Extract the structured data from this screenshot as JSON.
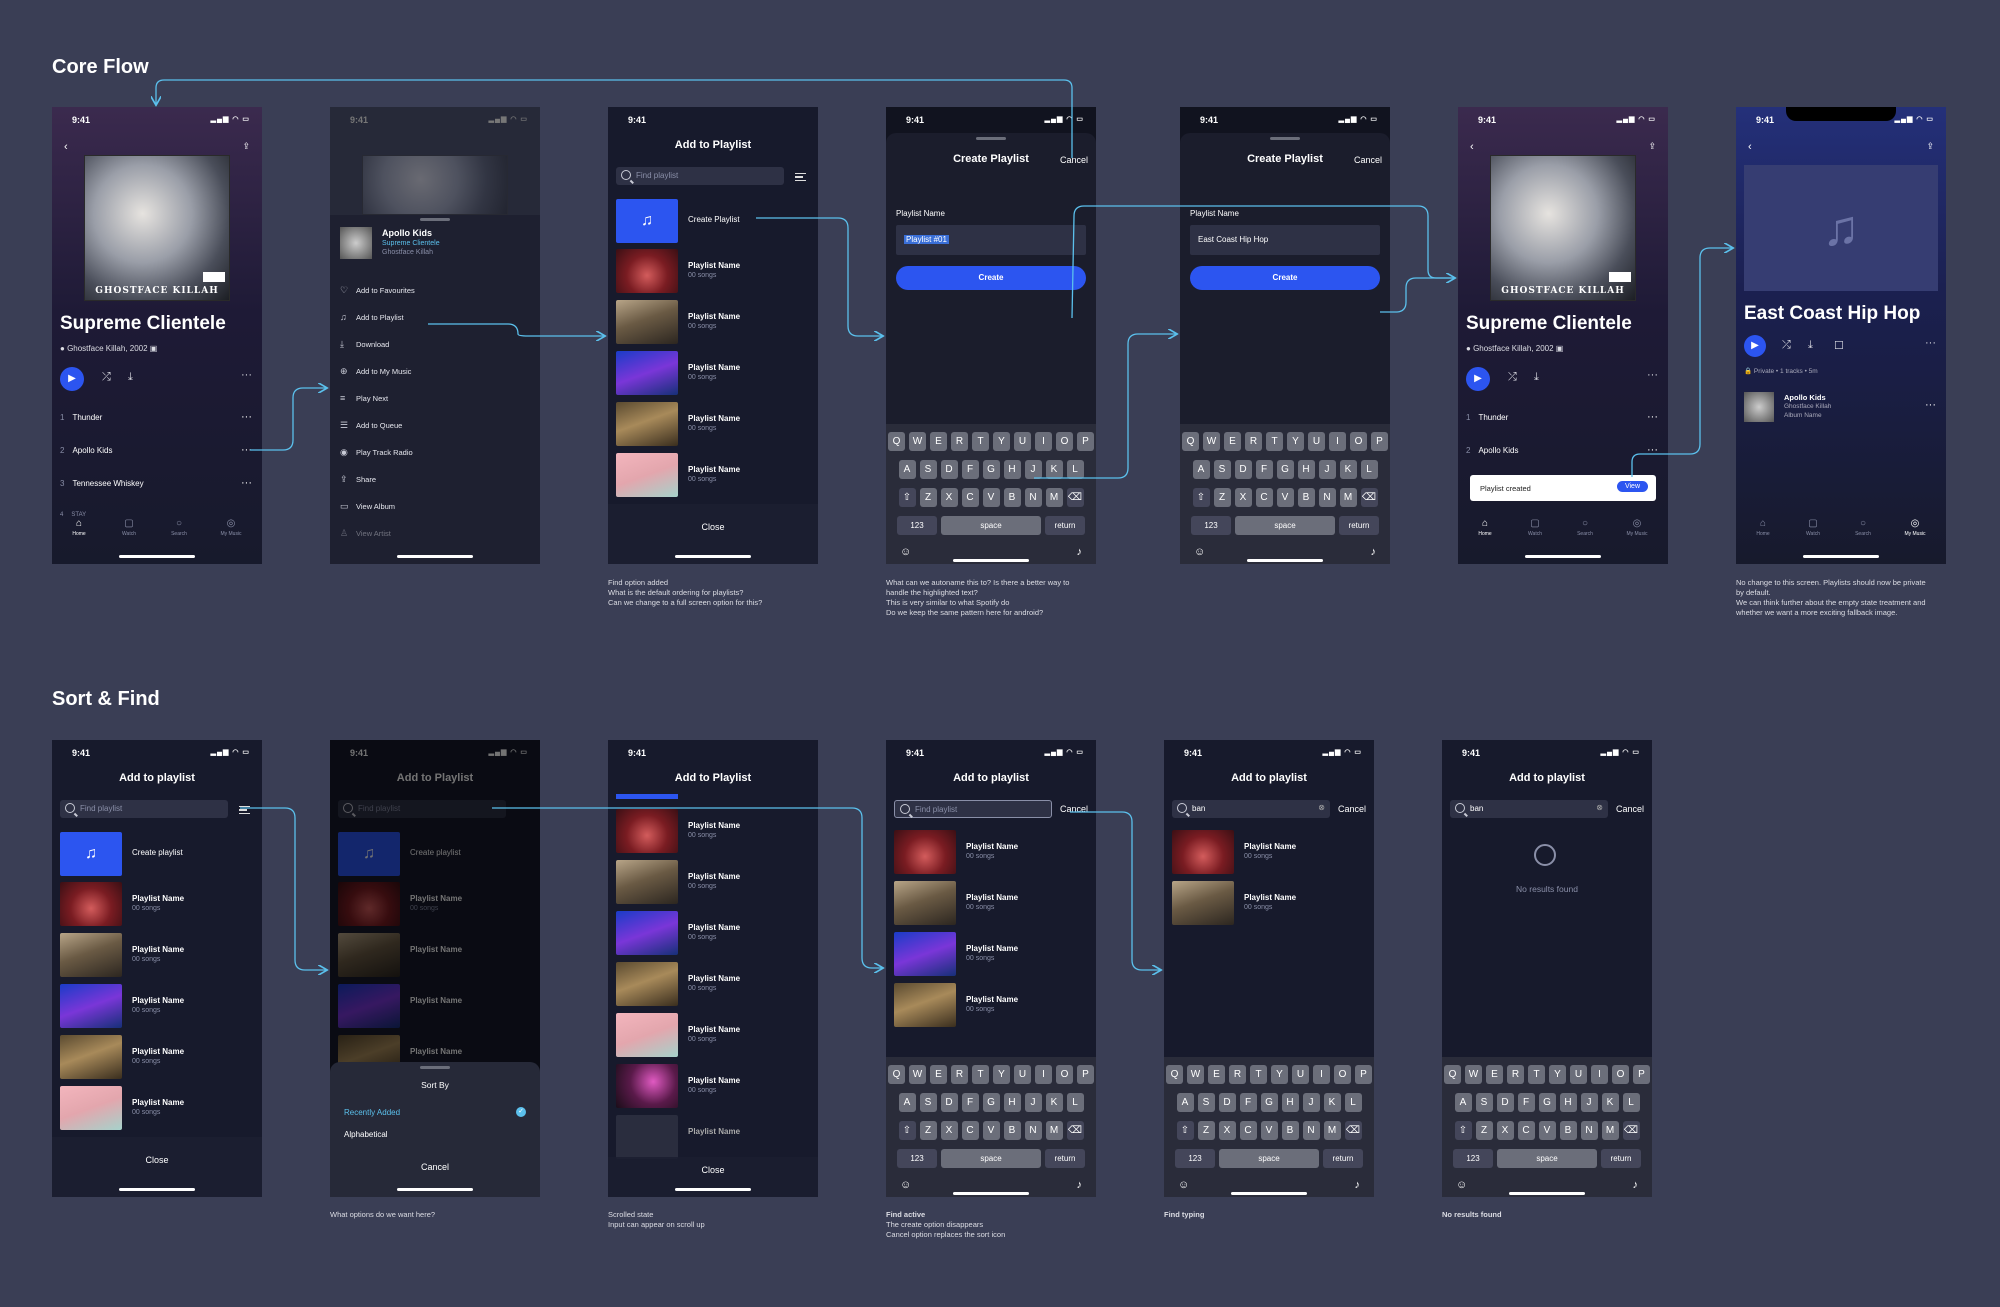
{
  "sections": {
    "core": "Core Flow",
    "sort": "Sort & Find"
  },
  "status": {
    "time": "9:41",
    "icons": "▂▄▆ ◠ ▭"
  },
  "album": {
    "title": "Supreme Clientele",
    "artist_line": "Ghostface Killah, 2002",
    "cover_text": "GHOSTFACE KILLAH",
    "tracks": [
      {
        "n": "1",
        "name": "Thunder"
      },
      {
        "n": "2",
        "name": "Apollo Kids"
      },
      {
        "n": "3",
        "name": "Tennessee Whiskey"
      },
      {
        "n": "4",
        "name": "STAY"
      }
    ]
  },
  "tabs": [
    "Home",
    "Watch",
    "Search",
    "My Music"
  ],
  "context_menu": {
    "track_title": "Apollo Kids",
    "track_album": "Supreme Clientele",
    "track_artist": "Ghostface Killah",
    "items": [
      "Add to Favourites",
      "Add to Playlist",
      "Download",
      "Add to My Music",
      "Play Next",
      "Add to Queue",
      "Play Track Radio",
      "Share",
      "View Album",
      "View Artist"
    ]
  },
  "add_playlist": {
    "title_a": "Add to Playlist",
    "title_b": "Add to playlist",
    "search_placeholder": "Find playlist",
    "create_a": "Create Playlist",
    "create_b": "Create playlist",
    "row_title": "Playlist Name",
    "row_sub": "00 songs",
    "close": "Close"
  },
  "create_playlist": {
    "title": "Create Playlist",
    "cancel": "Cancel",
    "field_label": "Playlist Name",
    "value_default": "Playlist #01",
    "value_typed": "East Coast Hip Hop",
    "button": "Create"
  },
  "keyboard": {
    "row1": [
      "Q",
      "W",
      "E",
      "R",
      "T",
      "Y",
      "U",
      "I",
      "O",
      "P"
    ],
    "row2": [
      "A",
      "S",
      "D",
      "F",
      "G",
      "H",
      "J",
      "K",
      "L"
    ],
    "row3": [
      "Z",
      "X",
      "C",
      "V",
      "B",
      "N",
      "M"
    ],
    "num": "123",
    "space": "space",
    "ret": "return"
  },
  "toast": {
    "text": "Playlist created",
    "action": "View"
  },
  "playlist_screen": {
    "title": "East Coast Hip Hop",
    "meta": "🔒 Private • 1 tracks • 5m",
    "track": "Apollo Kids",
    "artist": "Ghostface Killah",
    "album": "Album Name"
  },
  "sort_sheet": {
    "title": "Sort By",
    "opt1": "Recently Added",
    "opt2": "Alphabetical",
    "cancel": "Cancel"
  },
  "find": {
    "cancel": "Cancel",
    "query": "ban",
    "no_results": "No results found"
  },
  "notes": {
    "n3": [
      "Find option added",
      "What is the default ordering for playlists?",
      "Can we change to a full screen option for this?"
    ],
    "n4": [
      "What can we autoname this to? Is there a better way to",
      "handle the highlighted text?",
      "This is very similar to what Spotify do",
      "",
      "Do we keep the same pattern here for android?"
    ],
    "n7": [
      "No change to this screen. Playlists should now be private",
      "by default.",
      "",
      "We can think further about the empty state treatment and",
      "whether we want a more exciting fallback image."
    ],
    "s2": [
      "What options do we want here?"
    ],
    "s3": [
      "Scrolled state",
      "Input can appear on scroll up"
    ],
    "s4_b": "Find active",
    "s4": [
      "The create option disappears",
      "Cancel option replaces the sort icon"
    ],
    "s5_b": "Find typing",
    "s6_b": "No results found"
  },
  "colors": {
    "bg": "#3a3e55",
    "screen": "#171a2c",
    "accent": "#2c55f0",
    "flow_line": "#5bc0ec"
  }
}
